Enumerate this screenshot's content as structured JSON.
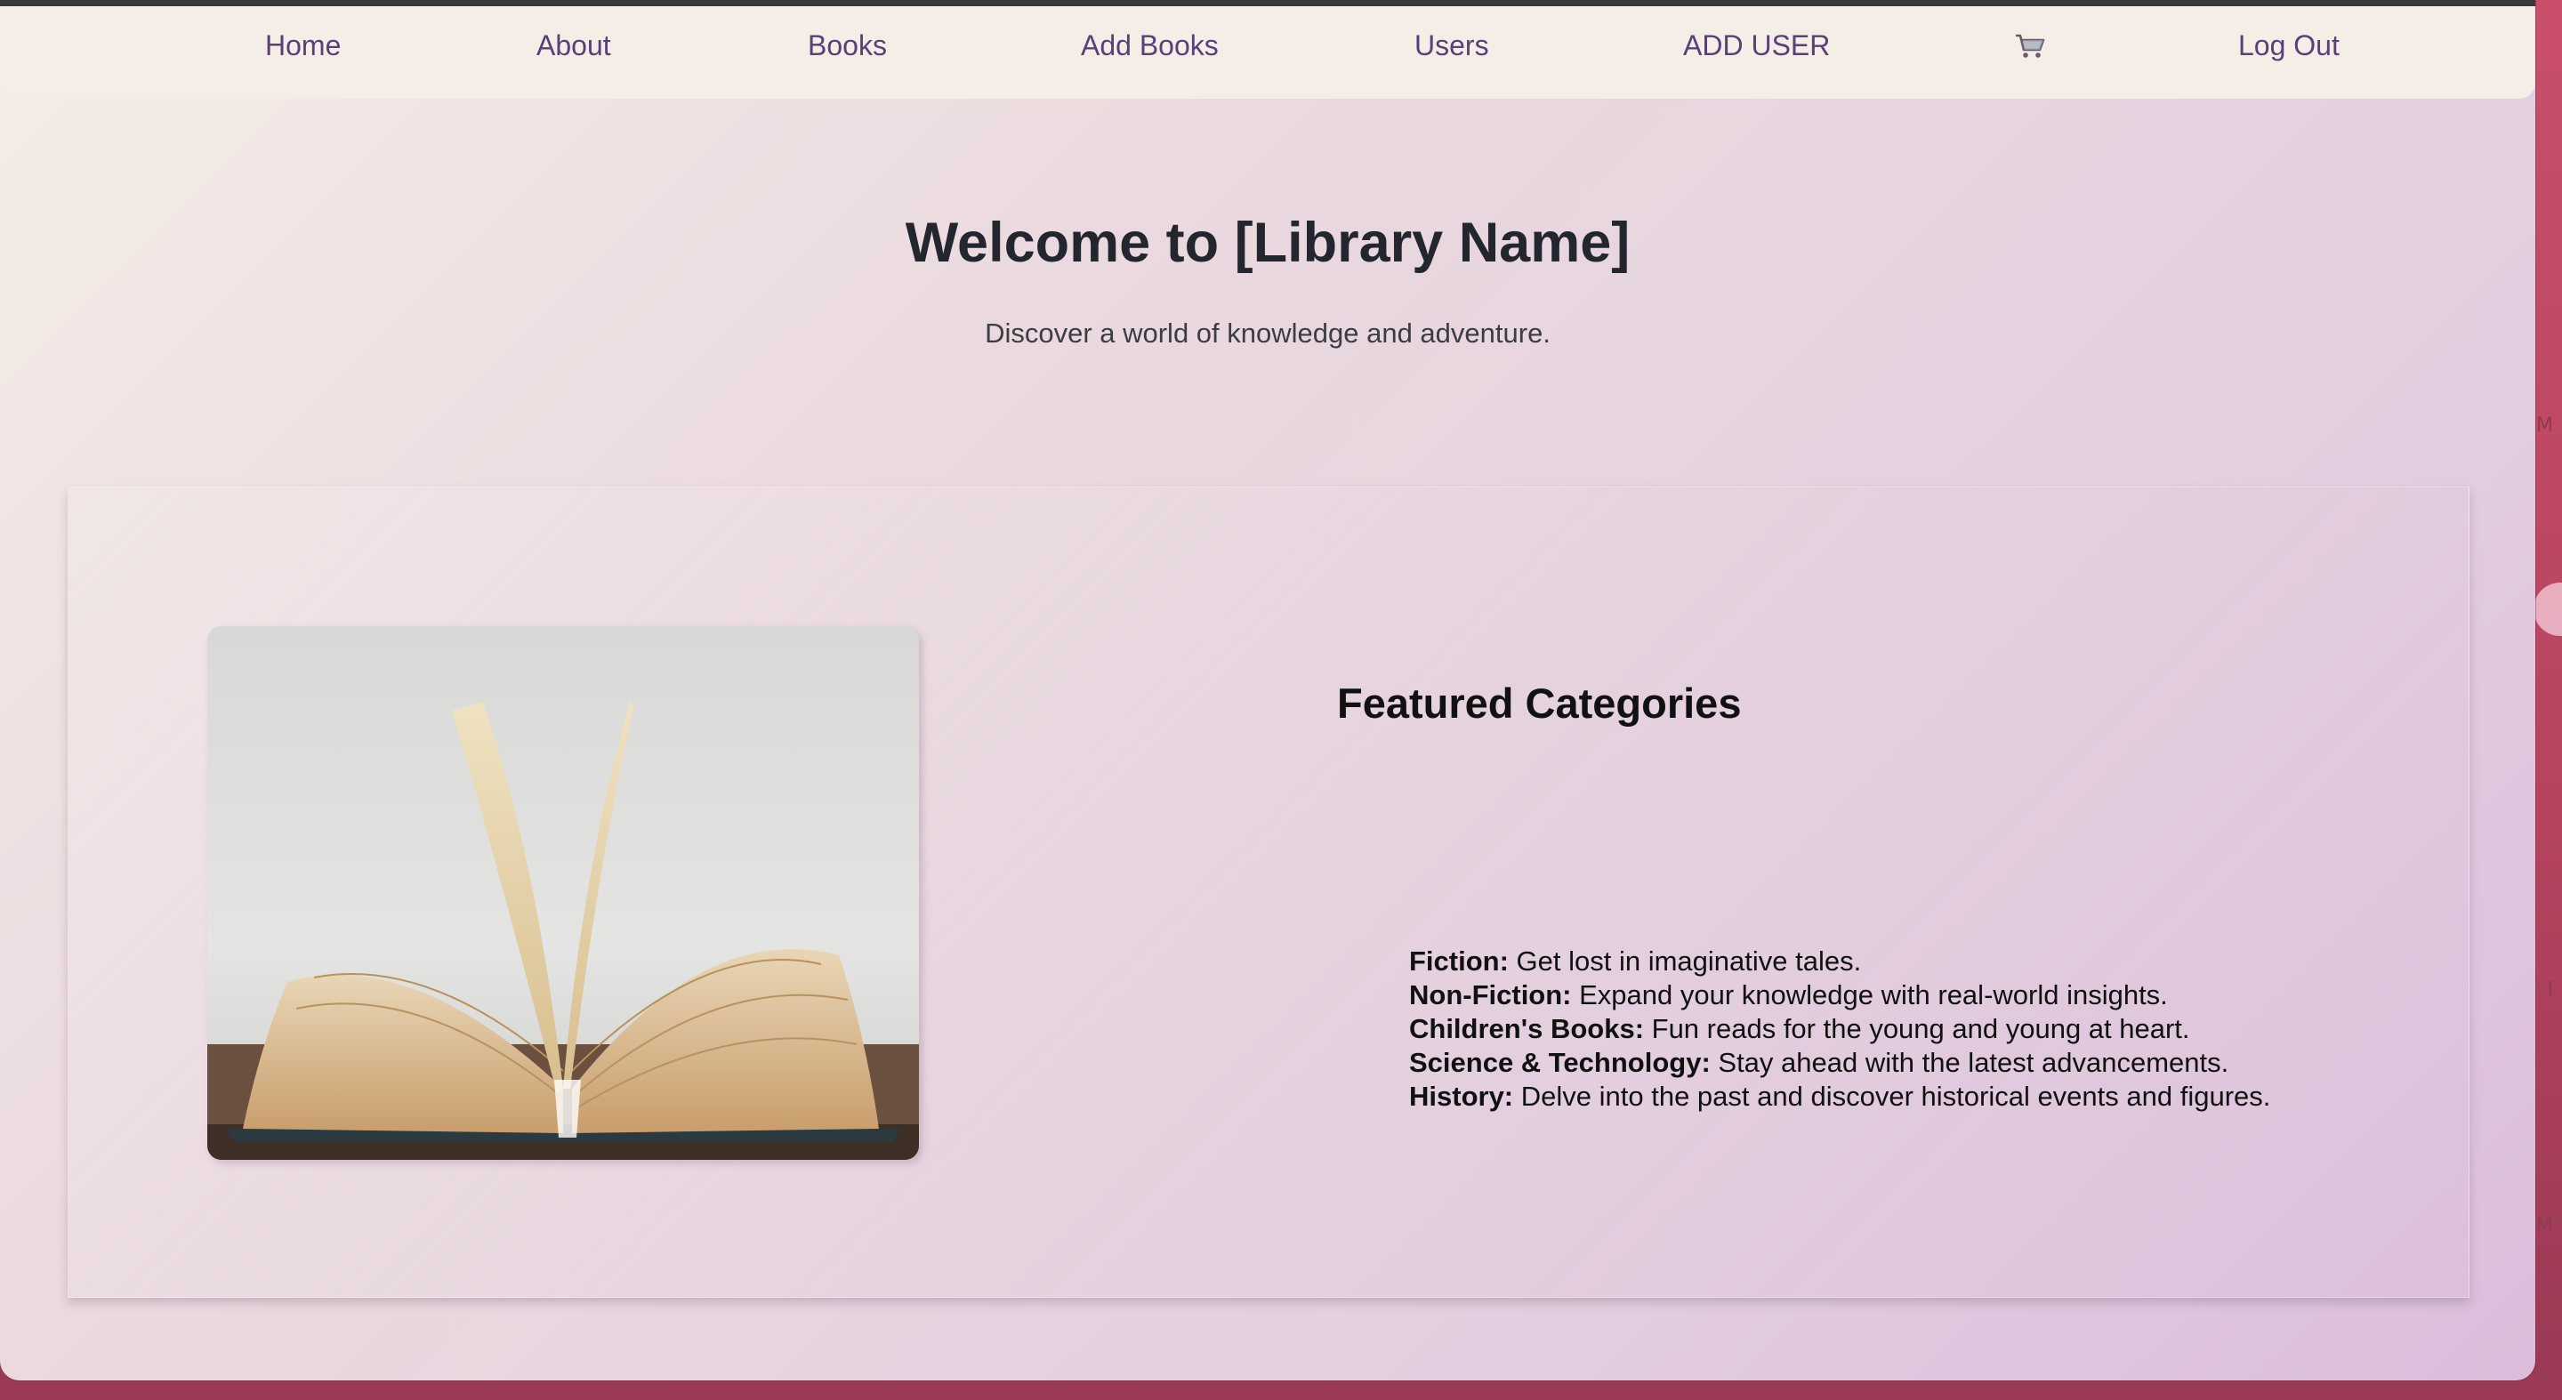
{
  "nav": {
    "items": [
      {
        "label": "Home"
      },
      {
        "label": "About"
      },
      {
        "label": "Books"
      },
      {
        "label": "Add Books"
      },
      {
        "label": "Users"
      },
      {
        "label": "ADD USER"
      },
      {
        "label": "Log Out"
      }
    ],
    "cart_icon": "shopping-cart-icon"
  },
  "hero": {
    "title": "Welcome to [Library Name]",
    "subtitle": "Discover a world of knowledge and adventure."
  },
  "featured": {
    "image_subject": "open-book-image",
    "title": "Featured Categories",
    "categories": [
      {
        "name": "Fiction:",
        "description": " Get lost in imaginative tales."
      },
      {
        "name": "Non-Fiction:",
        "description": " Expand your knowledge with real-world insights."
      },
      {
        "name": "Children's Books:",
        "description": " Fun reads for the young and young at heart."
      },
      {
        "name": "Science & Technology:",
        "description": " Stay ahead with the latest advancements."
      },
      {
        "name": "History:",
        "description": " Delve into the past and discover historical events and figures."
      }
    ]
  },
  "colors": {
    "nav_text": "#5b3e7a",
    "nav_bg": "#f5eee6",
    "heading": "#23262f"
  }
}
